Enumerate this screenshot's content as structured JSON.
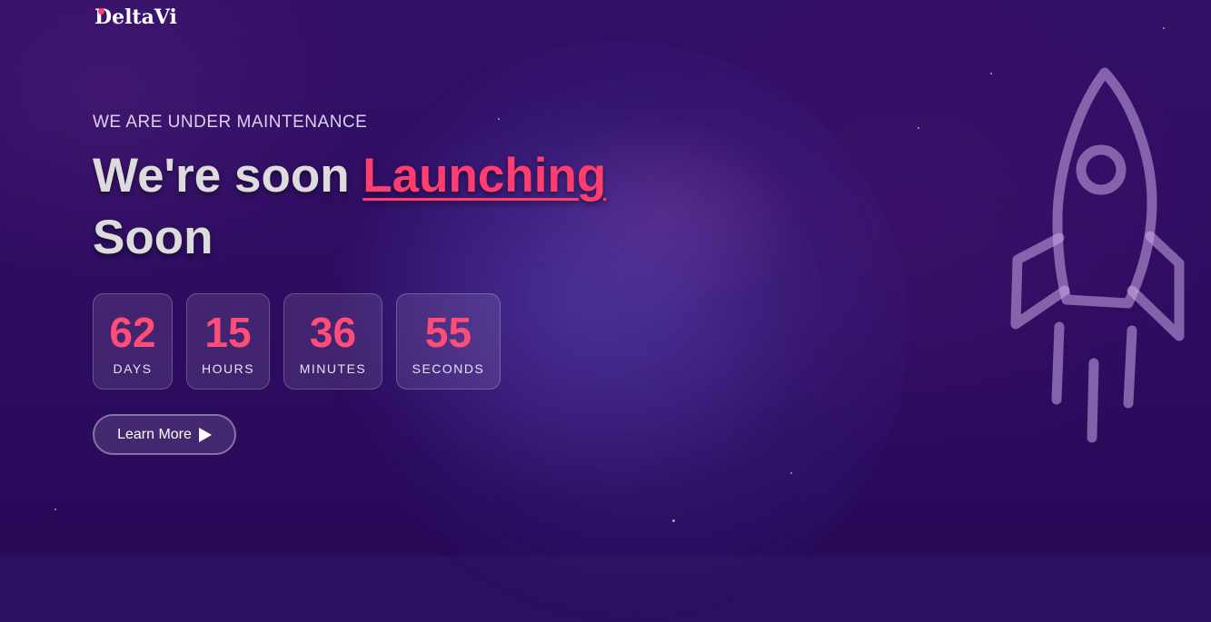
{
  "brand": {
    "logo_text": "DeltaVi"
  },
  "hero": {
    "kicker": "WE ARE UNDER MAINTENANCE",
    "headline_part1": "We're soon ",
    "headline_accent": "Launching",
    "headline_part2": "Soon"
  },
  "countdown": [
    {
      "value": "62",
      "label": "DAYS"
    },
    {
      "value": "15",
      "label": "HOURS"
    },
    {
      "value": "36",
      "label": "MINUTES"
    },
    {
      "value": "55",
      "label": "SECONDS"
    }
  ],
  "cta": {
    "label": "Learn More",
    "icon": "play-icon"
  },
  "colors": {
    "accent": "#ff3d6e",
    "background": "#2c0f5e"
  },
  "decor": {
    "icon": "rocket-icon"
  }
}
